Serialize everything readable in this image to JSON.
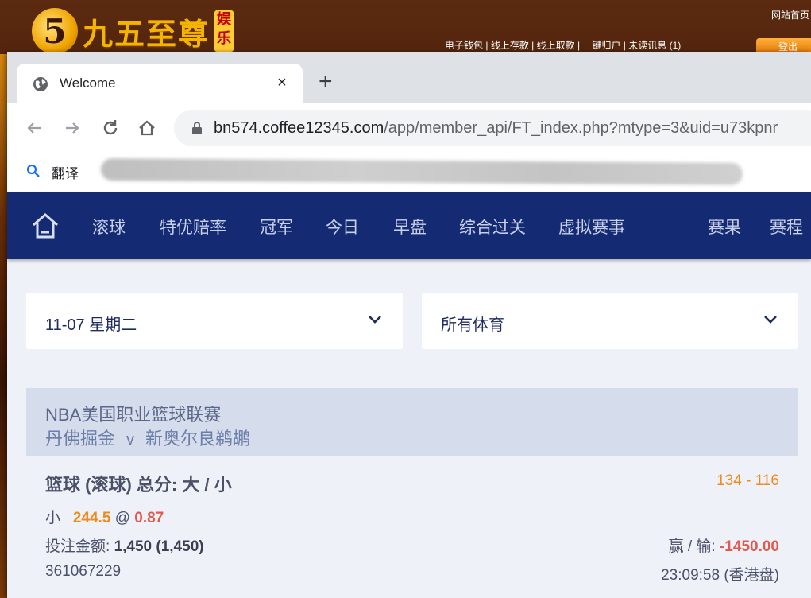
{
  "background_site": {
    "logo_digit": "5",
    "logo_text": "九五至尊",
    "logo_tag": "娱乐",
    "top_links": [
      "电子钱包",
      "线上存款",
      "线上取款",
      "一键归户",
      "未读讯息 (1)"
    ],
    "link_separator": " | ",
    "home_link": "网站首页",
    "login_button": "登出"
  },
  "browser": {
    "tab_title": "Welcome",
    "tab_close": "×",
    "new_tab": "+",
    "url_host": "bn574.coffee12345.com",
    "url_path": "/app/member_api/FT_index.php?mtype=3&uid=u73kpnr",
    "bookmark_translate": "翻译"
  },
  "nav": {
    "items": [
      "滚球",
      "特优赔率",
      "冠军",
      "今日",
      "早盘",
      "综合过关",
      "虚拟赛事",
      "赛果",
      "赛程"
    ]
  },
  "filters": {
    "date": "11-07 星期二",
    "sport": "所有体育"
  },
  "match": {
    "league": "NBA美国职业篮球联赛",
    "home_team": "丹佛掘金",
    "vs": "v",
    "away_team": "新奥尔良鹈鹕"
  },
  "bet": {
    "market": "篮球 (滚球) 总分: 大 / 小",
    "score": "134 - 116",
    "selection": "小",
    "line": "244.5",
    "at": "@",
    "odds": "0.87",
    "stake_label": "投注金额: ",
    "stake_value": "1,450 (1,450)",
    "winloss_label": "赢 / 输: ",
    "winloss_value": "-1450.00",
    "ticket_id": "361067229",
    "time": "23:09:58 (香港盘)"
  },
  "colors": {
    "navbar": "#142a73",
    "accent_orange": "#f08a1c",
    "accent_red": "#e4584d"
  }
}
